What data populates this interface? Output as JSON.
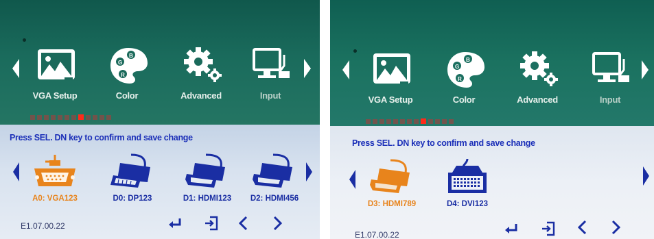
{
  "left_screen": {
    "menu": [
      {
        "label": "VGA Setup",
        "icon": "image-icon"
      },
      {
        "label": "Color",
        "icon": "palette-icon"
      },
      {
        "label": "Advanced",
        "icon": "gear-icon"
      },
      {
        "label": "Input",
        "icon": "monitor-input-icon"
      }
    ],
    "hint": "Press SEL. DN key to confirm and save change",
    "ports": [
      {
        "label": "A0: VGA123",
        "type": "VGA",
        "selected": true
      },
      {
        "label": "D0: DP123",
        "type": "DisplayPort",
        "selected": false
      },
      {
        "label": "D1: HDMI123",
        "type": "HDMI",
        "selected": false
      },
      {
        "label": "D2: HDMI456",
        "type": "HDMI",
        "selected": false
      }
    ],
    "version": "E1.07.00.22",
    "colors": {
      "selected": "#e8841c",
      "normal": "#1a2ea3"
    }
  },
  "right_screen": {
    "menu": [
      {
        "label": "VGA Setup",
        "icon": "image-icon"
      },
      {
        "label": "Color",
        "icon": "palette-icon"
      },
      {
        "label": "Advanced",
        "icon": "gear-icon"
      },
      {
        "label": "Input",
        "icon": "monitor-input-icon"
      }
    ],
    "hint": "Press SEL. DN key to confirm and save change",
    "ports": [
      {
        "label": "D3: HDMI789",
        "type": "HDMI",
        "selected": true
      },
      {
        "label": "D4: DVI123",
        "type": "DVI",
        "selected": false
      }
    ],
    "version": "E1.07.00.22"
  },
  "keys": [
    {
      "name": "enter",
      "icon": "enter-icon"
    },
    {
      "name": "exit",
      "icon": "exit-icon"
    },
    {
      "name": "left",
      "icon": "chevron-left-icon"
    },
    {
      "name": "right",
      "icon": "chevron-right-icon"
    }
  ]
}
